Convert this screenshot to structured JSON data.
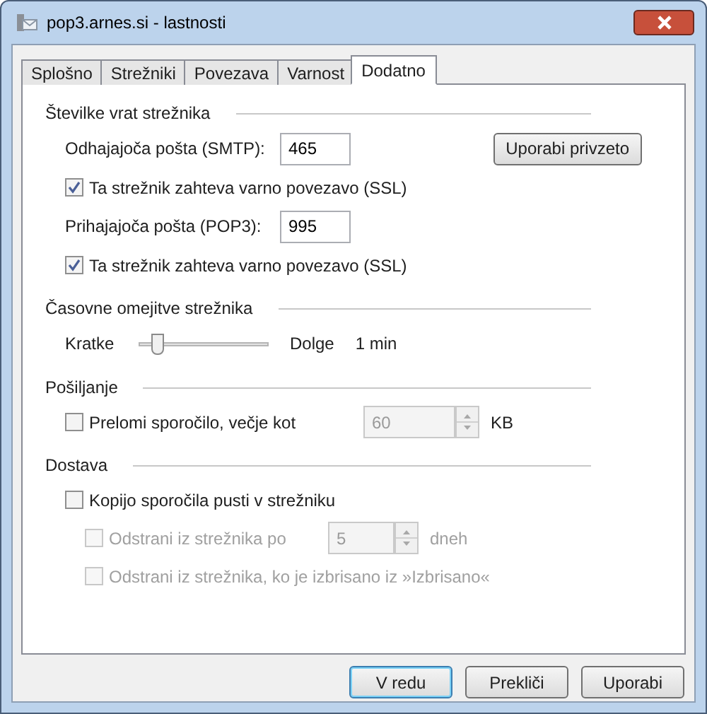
{
  "window": {
    "title": "pop3.arnes.si - lastnosti"
  },
  "tabs": [
    {
      "label": "Splošno",
      "selected": false
    },
    {
      "label": "Strežniki",
      "selected": false
    },
    {
      "label": "Povezava",
      "selected": false
    },
    {
      "label": "Varnost",
      "selected": false
    },
    {
      "label": "Dodatno",
      "selected": true
    }
  ],
  "sections": [
    {
      "title": "Številke vrat strežnika",
      "rows": [
        {
          "kind": "port",
          "label": "Odhajajoča pošta (SMTP):",
          "value": "465",
          "button": "Uporabi privzeto"
        },
        {
          "kind": "checkbox",
          "label": "Ta strežnik zahteva varno povezavo (SSL)",
          "checked": true,
          "disabled": false
        },
        {
          "kind": "port",
          "label": "Prihajajoča pošta (POP3):",
          "value": "995"
        },
        {
          "kind": "checkbox",
          "label": "Ta strežnik zahteva varno povezavo (SSL)",
          "checked": true,
          "disabled": false
        }
      ]
    },
    {
      "title": "Časovne omejitve strežnika",
      "rows": [
        {
          "kind": "slider",
          "min_label": "Kratke",
          "max_label": "Dolge",
          "reading": "1 min",
          "level": 0.15
        }
      ]
    },
    {
      "title": "Pošiljanje",
      "rows": [
        {
          "kind": "spin",
          "label": "Prelomi sporočilo, večje kot",
          "checked": false,
          "disabled": false,
          "value": "60",
          "value_disabled": true,
          "unit": "KB"
        }
      ]
    },
    {
      "title": "Dostava",
      "rows": [
        {
          "kind": "checkbox",
          "label": "Kopijo sporočila pusti v strežniku",
          "checked": false,
          "disabled": false,
          "children": [
            {
              "kind": "spin",
              "label": "Odstrani iz strežnika po",
              "checked": false,
              "disabled": true,
              "value": "5",
              "value_disabled": true,
              "unit": "dneh"
            },
            {
              "kind": "checkbox",
              "label": "Odstrani iz strežnika, ko je izbrisano iz »Izbrisano«",
              "checked": false,
              "disabled": true
            }
          ]
        }
      ]
    }
  ],
  "buttons": [
    {
      "label": "V redu",
      "default": true
    },
    {
      "label": "Prekliči",
      "default": false
    },
    {
      "label": "Uporabi",
      "default": false
    }
  ]
}
